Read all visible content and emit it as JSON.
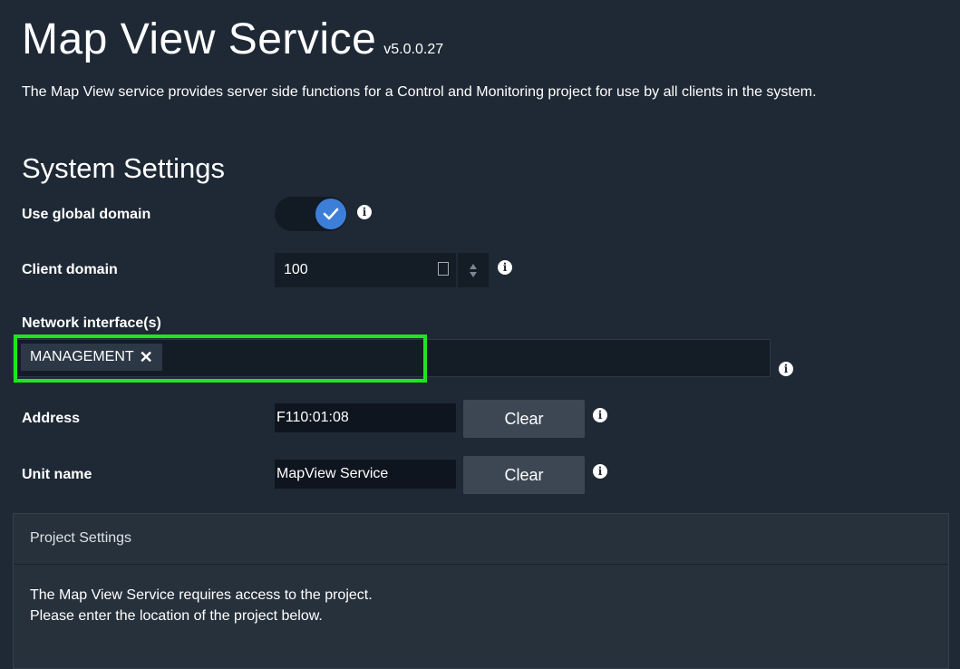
{
  "header": {
    "title": "Map View Service",
    "version": "v5.0.0.27",
    "description": "The Map View service provides server side functions for a Control and Monitoring project for use by all clients in the system."
  },
  "system_settings": {
    "heading": "System Settings",
    "use_global_domain": {
      "label": "Use global domain",
      "checked": true
    },
    "client_domain": {
      "label": "Client domain",
      "value": "100"
    },
    "network_interfaces": {
      "label": "Network interface(s)",
      "tags": [
        "MANAGEMENT"
      ],
      "remove_glyph": "✕"
    },
    "address": {
      "label": "Address",
      "value": "F110:01:08",
      "clear_label": "Clear"
    },
    "unit_name": {
      "label": "Unit name",
      "value": "MapView Service",
      "clear_label": "Clear"
    }
  },
  "project_settings": {
    "title": "Project Settings",
    "body": "The Map View Service requires access to the project. Please enter the location of the project below."
  },
  "icons": {
    "info": "info-icon",
    "check": "check-icon",
    "calculator": "calculator-icon"
  },
  "colors": {
    "background": "#1f2935",
    "accent": "#3d7fd8",
    "highlight": "#1ee61e"
  }
}
